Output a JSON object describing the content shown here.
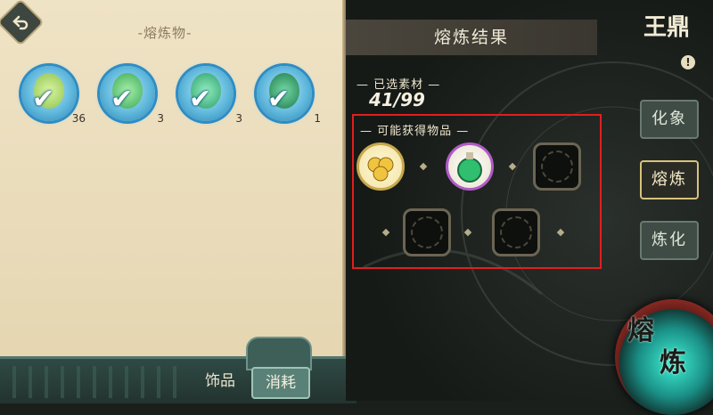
{
  "left": {
    "back_icon": "back-arrow-icon",
    "title": "-熔炼物-",
    "items": [
      {
        "count": "36",
        "gem_color": "#b7e67a"
      },
      {
        "count": "3",
        "gem_color": "#59c86a"
      },
      {
        "count": "3",
        "gem_color": "#3dbf78"
      },
      {
        "count": "1",
        "gem_color": "#2e9b6a"
      }
    ]
  },
  "tabs": {
    "ornaments": "饰品",
    "consumables": "消耗",
    "active": "consumables"
  },
  "result": {
    "header": "熔炼结果",
    "selected_label": "已选素材",
    "selected_count": "41/99",
    "possible_label": "可能获得物品",
    "slots": [
      {
        "state": "filled",
        "icon": "gold-coins-icon",
        "color": "#f1c440"
      },
      {
        "state": "filled",
        "icon": "green-potion-icon",
        "color": "#2fbf6f"
      },
      {
        "state": "empty"
      },
      {
        "state": "empty"
      },
      {
        "state": "empty"
      }
    ]
  },
  "side_menu": {
    "logo_text": "王鼎",
    "info_badge": "!",
    "buttons": [
      {
        "label": "化象",
        "active": false
      },
      {
        "label": "熔炼",
        "active": true
      },
      {
        "label": "炼化",
        "active": false
      }
    ]
  },
  "action": {
    "fuse_label_1": "熔",
    "fuse_label_2": "炼"
  },
  "colors": {
    "accent_teal": "#3ff0d4",
    "highlight_box": "#e01f1f",
    "check_blue": "#2e8dc4"
  }
}
